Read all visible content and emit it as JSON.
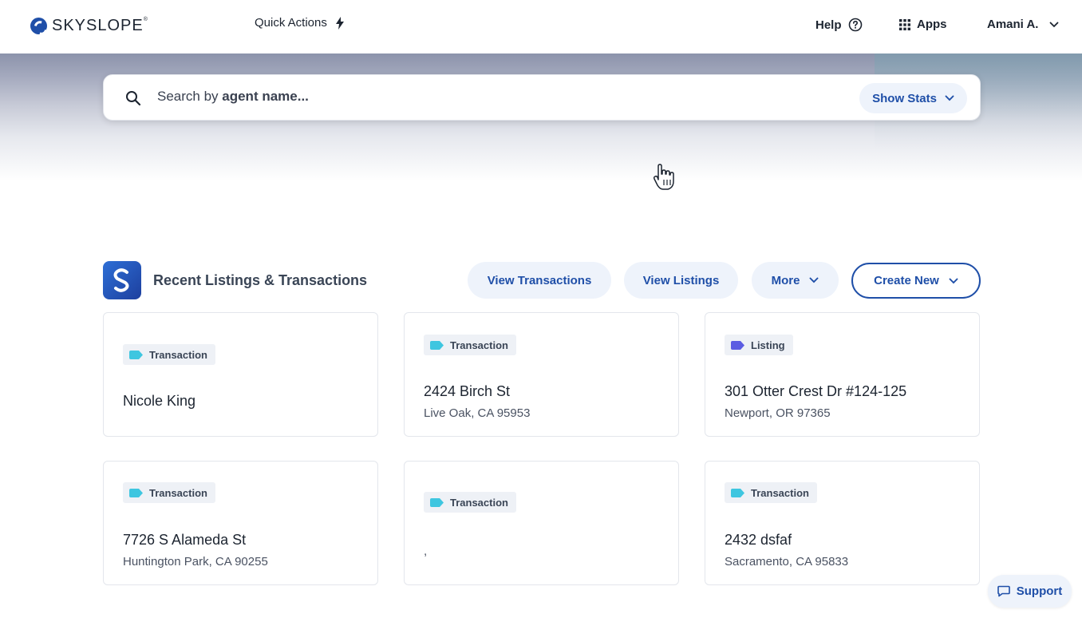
{
  "header": {
    "brand": "SKYSLOPE",
    "brand_mark": "®",
    "quick_actions": "Quick Actions",
    "help": "Help",
    "apps": "Apps",
    "user": "Amani A."
  },
  "search": {
    "placeholder_prefix": "Search by ",
    "placeholder_bold": "agent name...",
    "show_stats": "Show Stats"
  },
  "section": {
    "title": "Recent Listings & Transactions",
    "view_transactions": "View Transactions",
    "view_listings": "View Listings",
    "more": "More",
    "create_new": "Create New"
  },
  "cards": [
    {
      "type": "Transaction",
      "tag_color": "#3ec6e0",
      "title": "Nicole King",
      "subtitle": ""
    },
    {
      "type": "Transaction",
      "tag_color": "#3ec6e0",
      "title": "2424 Birch St",
      "subtitle": "Live Oak, CA 95953"
    },
    {
      "type": "Listing",
      "tag_color": "#5b5ce2",
      "title": "301 Otter Crest Dr #124-125",
      "subtitle": "Newport, OR 97365"
    },
    {
      "type": "Transaction",
      "tag_color": "#3ec6e0",
      "title": "7726 S Alameda St",
      "subtitle": "Huntington Park, CA 90255"
    },
    {
      "type": "Transaction",
      "tag_color": "#3ec6e0",
      "title": "",
      "subtitle": ","
    },
    {
      "type": "Transaction",
      "tag_color": "#3ec6e0",
      "title": "2432 dsfaf",
      "subtitle": "Sacramento, CA 95833"
    }
  ],
  "support": "Support",
  "colors": {
    "accent": "#1f4fa8",
    "pill_bg": "#eef3fb"
  }
}
